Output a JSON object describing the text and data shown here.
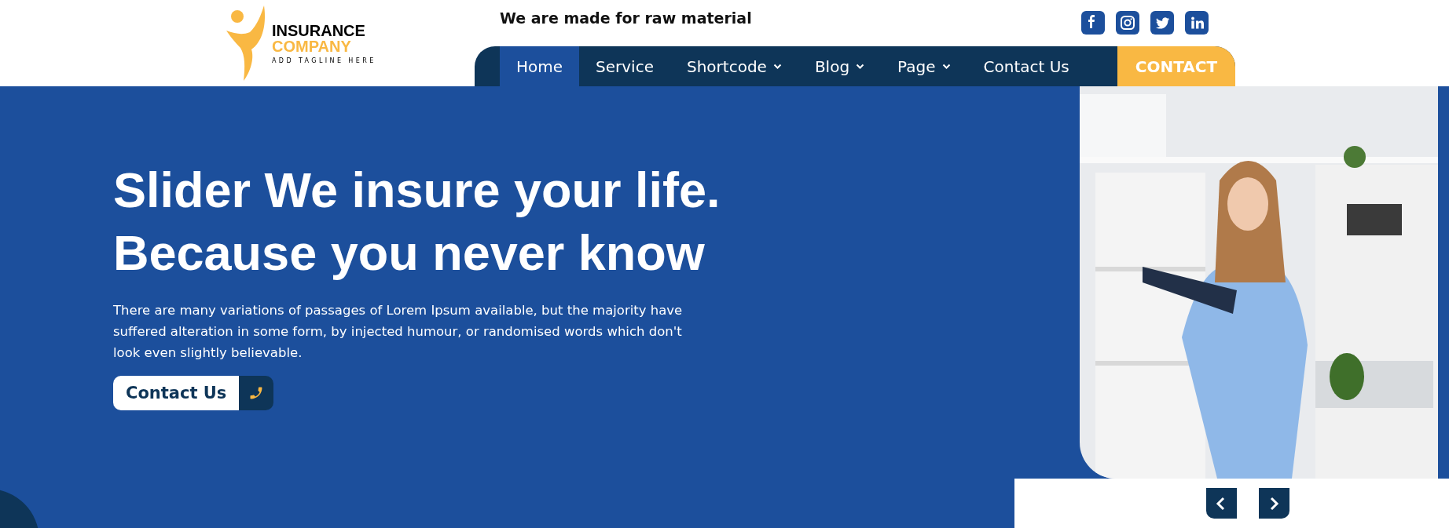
{
  "logo": {
    "line1": "INSURANCE",
    "line2": "COMPANY",
    "tagline": "ADD TAGLINE HERE"
  },
  "top_bar": {
    "tagline": "We are made for raw material"
  },
  "social_links": [
    {
      "kind": "facebook"
    },
    {
      "kind": "instagram"
    },
    {
      "kind": "twitter"
    },
    {
      "kind": "linkedin"
    }
  ],
  "nav": {
    "items": [
      {
        "label": "Home",
        "selected": true,
        "dropdown": false
      },
      {
        "label": "Service",
        "selected": false,
        "dropdown": false
      },
      {
        "label": "Shortcode",
        "selected": false,
        "dropdown": true
      },
      {
        "label": "Blog",
        "selected": false,
        "dropdown": true
      },
      {
        "label": "Page",
        "selected": false,
        "dropdown": true
      },
      {
        "label": "Contact Us",
        "selected": false,
        "dropdown": false
      }
    ],
    "contact_button": "CONTACT"
  },
  "hero": {
    "title_lines": [
      "Slider We insure your life.",
      "Because you never know"
    ],
    "description": "There are many variations of passages of Lorem Ipsum available, but the majority have suffered alteration in some form, by injected humour, or randomised words which don't look even slightly believable.",
    "button": "Contact Us"
  }
}
